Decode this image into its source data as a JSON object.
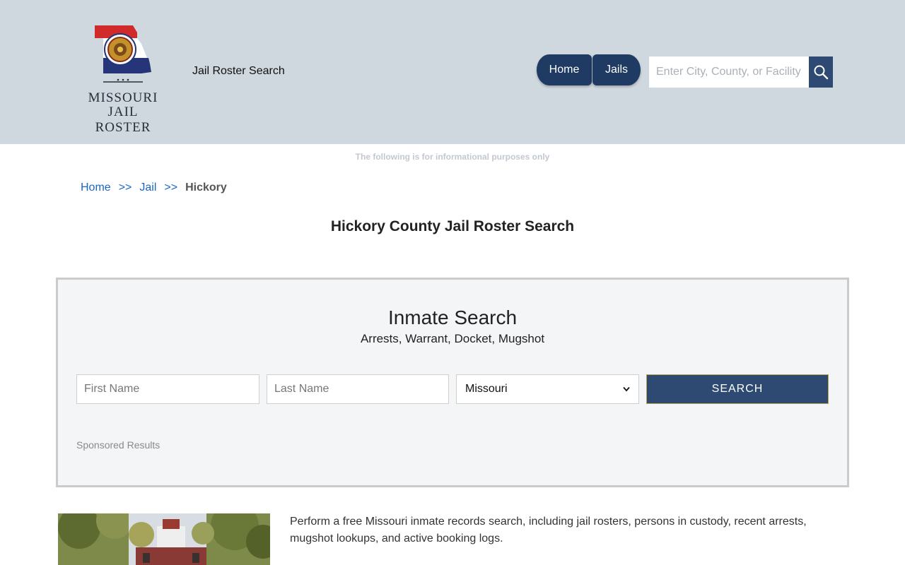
{
  "header": {
    "logo_line1": "MISSOURI",
    "logo_line2": "JAIL ROSTER",
    "site_title": "Jail Roster Search",
    "nav": [
      {
        "label": "Home"
      },
      {
        "label": "Jails"
      }
    ],
    "search_placeholder": "Enter City, County, or Facility"
  },
  "disclaimer": "The following is for informational purposes only",
  "breadcrumb": {
    "items": [
      "Home",
      "Jail"
    ],
    "separator": ">>",
    "current": "Hickory"
  },
  "page_title": "Hickory County Jail Roster Search",
  "inmate_search": {
    "title": "Inmate Search",
    "subtitle": "Arrests, Warrant, Docket, Mugshot",
    "first_name_placeholder": "First Name",
    "last_name_placeholder": "Last Name",
    "state_selected": "Missouri",
    "search_label": "SEARCH",
    "sponsored_label": "Sponsored Results"
  },
  "intro_text": "Perform a free Missouri inmate records search, including jail rosters, persons in custody, recent arrests, mugshot lookups, and active booking logs.",
  "colors": {
    "header_bg": "#cfd7df",
    "nav_bg": "#1f3a63",
    "button_bg": "#2e4a73",
    "link": "#1a66c2"
  }
}
